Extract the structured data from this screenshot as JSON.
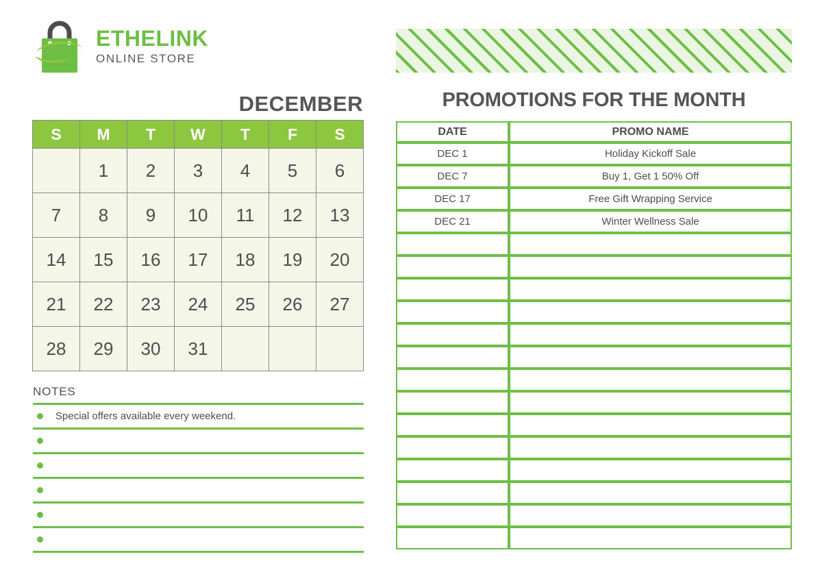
{
  "brand": {
    "logo_icon": "shopping-bag-icon",
    "name": "ETHELINK",
    "tagline": "ONLINE STORE",
    "accent_color": "#6DBE45",
    "bag_color": "#6DBE45",
    "handle_color": "#4D4D4D"
  },
  "banner": {
    "pattern": "diagonal-stripes",
    "stripe_color": "#6DBE45",
    "background_color": "#EAF6E2"
  },
  "calendar": {
    "month_title": "DECEMBER",
    "header_background": "#8DC63F",
    "cell_background": "#F4F7E8",
    "weekdays": [
      "S",
      "M",
      "T",
      "W",
      "T",
      "F",
      "S"
    ],
    "weeks": [
      [
        "",
        "1",
        "2",
        "3",
        "4",
        "5",
        "6"
      ],
      [
        "7",
        "8",
        "9",
        "10",
        "11",
        "12",
        "13"
      ],
      [
        "14",
        "15",
        "16",
        "17",
        "18",
        "19",
        "20"
      ],
      [
        "21",
        "22",
        "23",
        "24",
        "25",
        "26",
        "27"
      ],
      [
        "28",
        "29",
        "30",
        "31",
        "",
        "",
        ""
      ]
    ]
  },
  "notes": {
    "title": "NOTES",
    "line_color": "#6DBE45",
    "bullet_icon": "dot-bullet-icon",
    "items": [
      "Special offers available every weekend.",
      "",
      "",
      "",
      "",
      ""
    ]
  },
  "promotions": {
    "title": "PROMOTIONS FOR THE MONTH",
    "border_color": "#6DBE45",
    "columns": [
      "DATE",
      "PROMO NAME"
    ],
    "rows": [
      {
        "date": "DEC 1",
        "promo": "Holiday Kickoff Sale"
      },
      {
        "date": "DEC 7",
        "promo": "Buy 1, Get 1 50% Off"
      },
      {
        "date": "DEC 17",
        "promo": "Free Gift Wrapping Service"
      },
      {
        "date": "DEC 21",
        "promo": "Winter Wellness Sale"
      },
      {
        "date": "",
        "promo": ""
      },
      {
        "date": "",
        "promo": ""
      },
      {
        "date": "",
        "promo": ""
      },
      {
        "date": "",
        "promo": ""
      },
      {
        "date": "",
        "promo": ""
      },
      {
        "date": "",
        "promo": ""
      },
      {
        "date": "",
        "promo": ""
      },
      {
        "date": "",
        "promo": ""
      },
      {
        "date": "",
        "promo": ""
      },
      {
        "date": "",
        "promo": ""
      },
      {
        "date": "",
        "promo": ""
      },
      {
        "date": "",
        "promo": ""
      },
      {
        "date": "",
        "promo": ""
      },
      {
        "date": "",
        "promo": ""
      }
    ]
  }
}
